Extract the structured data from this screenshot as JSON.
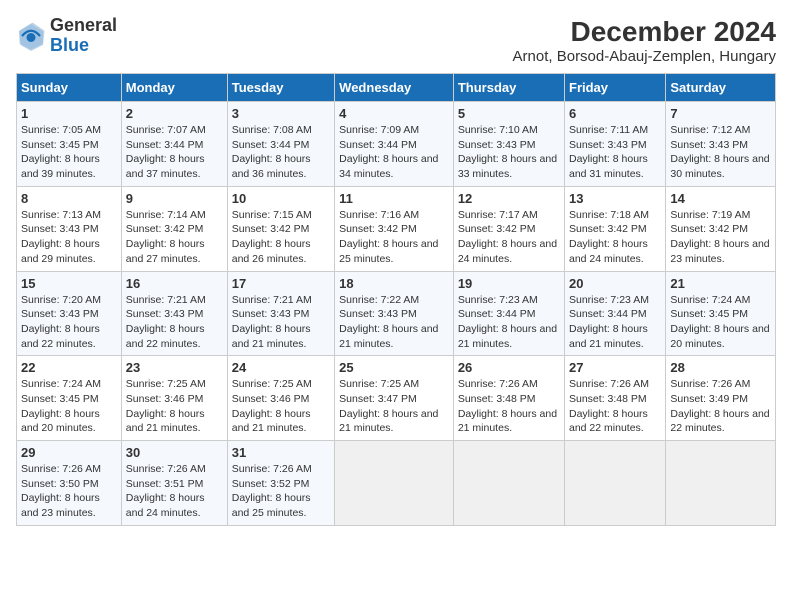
{
  "logo": {
    "text_general": "General",
    "text_blue": "Blue"
  },
  "title": "December 2024",
  "subtitle": "Arnot, Borsod-Abauj-Zemplen, Hungary",
  "headers": [
    "Sunday",
    "Monday",
    "Tuesday",
    "Wednesday",
    "Thursday",
    "Friday",
    "Saturday"
  ],
  "weeks": [
    [
      {
        "day": "1",
        "sunrise": "7:05 AM",
        "sunset": "3:45 PM",
        "daylight": "8 hours and 39 minutes."
      },
      {
        "day": "2",
        "sunrise": "7:07 AM",
        "sunset": "3:44 PM",
        "daylight": "8 hours and 37 minutes."
      },
      {
        "day": "3",
        "sunrise": "7:08 AM",
        "sunset": "3:44 PM",
        "daylight": "8 hours and 36 minutes."
      },
      {
        "day": "4",
        "sunrise": "7:09 AM",
        "sunset": "3:44 PM",
        "daylight": "8 hours and 34 minutes."
      },
      {
        "day": "5",
        "sunrise": "7:10 AM",
        "sunset": "3:43 PM",
        "daylight": "8 hours and 33 minutes."
      },
      {
        "day": "6",
        "sunrise": "7:11 AM",
        "sunset": "3:43 PM",
        "daylight": "8 hours and 31 minutes."
      },
      {
        "day": "7",
        "sunrise": "7:12 AM",
        "sunset": "3:43 PM",
        "daylight": "8 hours and 30 minutes."
      }
    ],
    [
      {
        "day": "8",
        "sunrise": "7:13 AM",
        "sunset": "3:43 PM",
        "daylight": "8 hours and 29 minutes."
      },
      {
        "day": "9",
        "sunrise": "7:14 AM",
        "sunset": "3:42 PM",
        "daylight": "8 hours and 27 minutes."
      },
      {
        "day": "10",
        "sunrise": "7:15 AM",
        "sunset": "3:42 PM",
        "daylight": "8 hours and 26 minutes."
      },
      {
        "day": "11",
        "sunrise": "7:16 AM",
        "sunset": "3:42 PM",
        "daylight": "8 hours and 25 minutes."
      },
      {
        "day": "12",
        "sunrise": "7:17 AM",
        "sunset": "3:42 PM",
        "daylight": "8 hours and 24 minutes."
      },
      {
        "day": "13",
        "sunrise": "7:18 AM",
        "sunset": "3:42 PM",
        "daylight": "8 hours and 24 minutes."
      },
      {
        "day": "14",
        "sunrise": "7:19 AM",
        "sunset": "3:42 PM",
        "daylight": "8 hours and 23 minutes."
      }
    ],
    [
      {
        "day": "15",
        "sunrise": "7:20 AM",
        "sunset": "3:43 PM",
        "daylight": "8 hours and 22 minutes."
      },
      {
        "day": "16",
        "sunrise": "7:21 AM",
        "sunset": "3:43 PM",
        "daylight": "8 hours and 22 minutes."
      },
      {
        "day": "17",
        "sunrise": "7:21 AM",
        "sunset": "3:43 PM",
        "daylight": "8 hours and 21 minutes."
      },
      {
        "day": "18",
        "sunrise": "7:22 AM",
        "sunset": "3:43 PM",
        "daylight": "8 hours and 21 minutes."
      },
      {
        "day": "19",
        "sunrise": "7:23 AM",
        "sunset": "3:44 PM",
        "daylight": "8 hours and 21 minutes."
      },
      {
        "day": "20",
        "sunrise": "7:23 AM",
        "sunset": "3:44 PM",
        "daylight": "8 hours and 21 minutes."
      },
      {
        "day": "21",
        "sunrise": "7:24 AM",
        "sunset": "3:45 PM",
        "daylight": "8 hours and 20 minutes."
      }
    ],
    [
      {
        "day": "22",
        "sunrise": "7:24 AM",
        "sunset": "3:45 PM",
        "daylight": "8 hours and 20 minutes."
      },
      {
        "day": "23",
        "sunrise": "7:25 AM",
        "sunset": "3:46 PM",
        "daylight": "8 hours and 21 minutes."
      },
      {
        "day": "24",
        "sunrise": "7:25 AM",
        "sunset": "3:46 PM",
        "daylight": "8 hours and 21 minutes."
      },
      {
        "day": "25",
        "sunrise": "7:25 AM",
        "sunset": "3:47 PM",
        "daylight": "8 hours and 21 minutes."
      },
      {
        "day": "26",
        "sunrise": "7:26 AM",
        "sunset": "3:48 PM",
        "daylight": "8 hours and 21 minutes."
      },
      {
        "day": "27",
        "sunrise": "7:26 AM",
        "sunset": "3:48 PM",
        "daylight": "8 hours and 22 minutes."
      },
      {
        "day": "28",
        "sunrise": "7:26 AM",
        "sunset": "3:49 PM",
        "daylight": "8 hours and 22 minutes."
      }
    ],
    [
      {
        "day": "29",
        "sunrise": "7:26 AM",
        "sunset": "3:50 PM",
        "daylight": "8 hours and 23 minutes."
      },
      {
        "day": "30",
        "sunrise": "7:26 AM",
        "sunset": "3:51 PM",
        "daylight": "8 hours and 24 minutes."
      },
      {
        "day": "31",
        "sunrise": "7:26 AM",
        "sunset": "3:52 PM",
        "daylight": "8 hours and 25 minutes."
      },
      null,
      null,
      null,
      null
    ]
  ]
}
